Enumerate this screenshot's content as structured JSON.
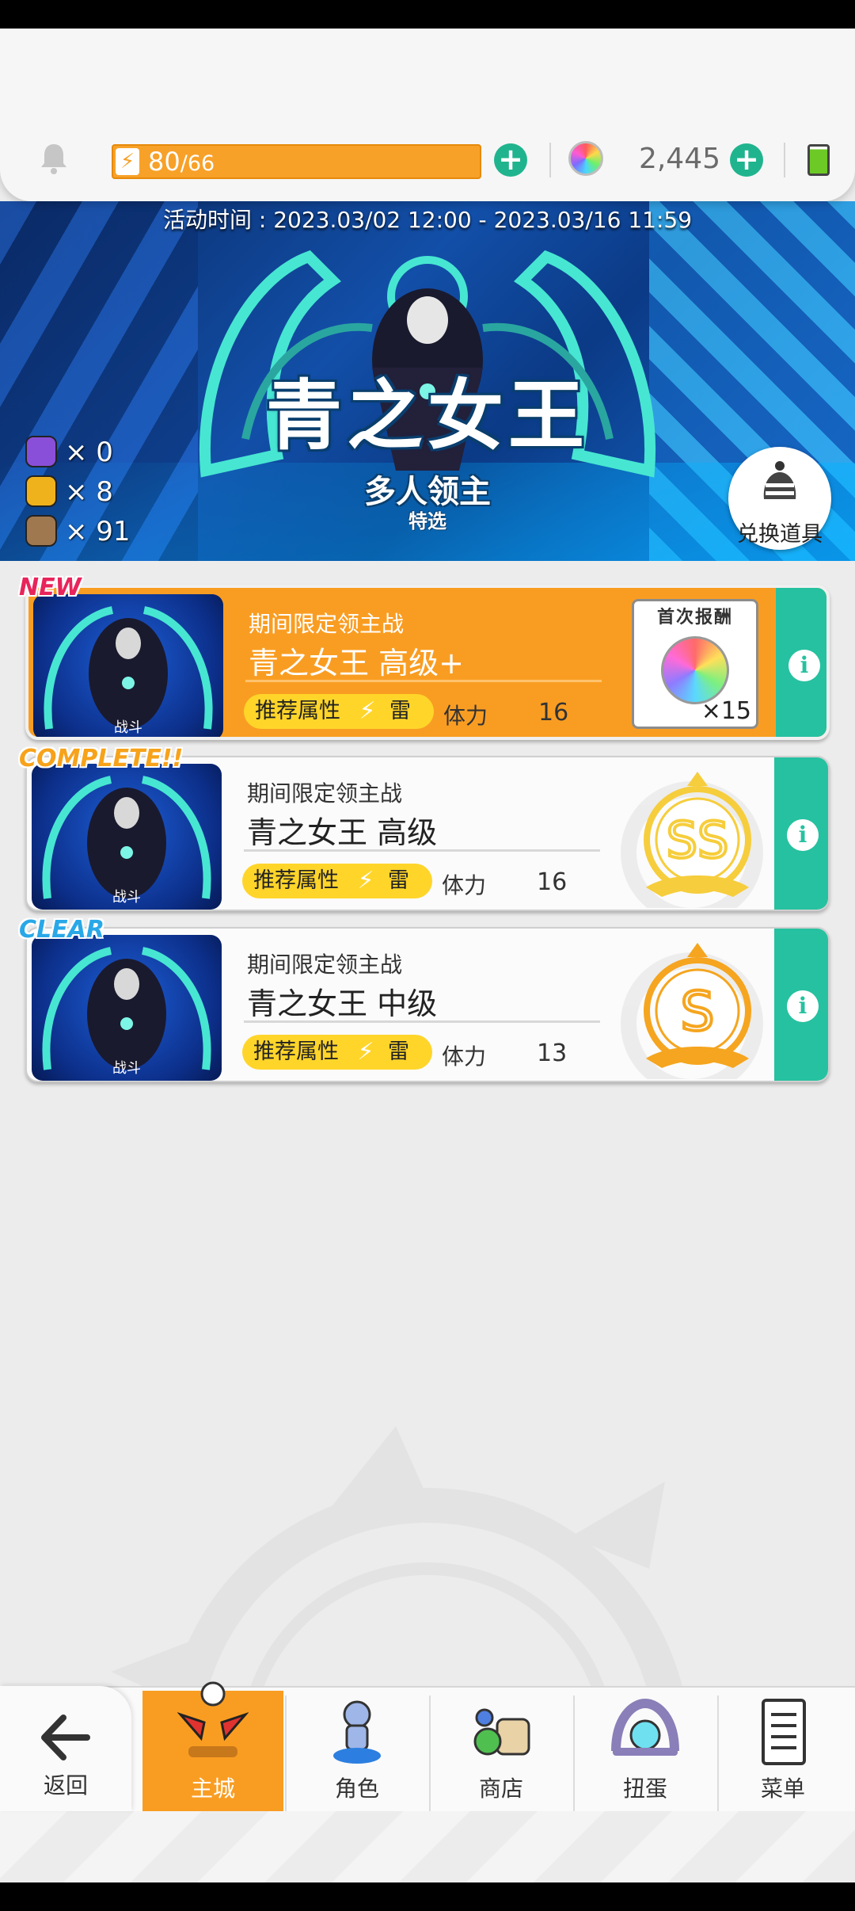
{
  "hud": {
    "stamina_current": "80",
    "stamina_max": "/66",
    "gems": "2,445"
  },
  "banner": {
    "event_time": "活动时间 : 2023.03/02 12:00 - 2023.03/16 11:59",
    "title": "青之女王",
    "subtitle": "多人领主",
    "tag": "特选",
    "tokens": [
      {
        "icon": "purple-token-icon",
        "count": "× 0",
        "color": "#8a4fd8"
      },
      {
        "icon": "gold-token-icon",
        "count": "× 8",
        "color": "#f0b21c"
      },
      {
        "icon": "bronze-token-icon",
        "count": "× 91",
        "color": "#a07850"
      }
    ],
    "exchange_label": "兑换道具"
  },
  "stages": [
    {
      "badge": "NEW",
      "fight_label": "战斗",
      "subtitle": "期间限定领主战",
      "name": "青之女王 高级+",
      "attr_label": "推荐属性",
      "element": "雷",
      "stamina_label": "体力",
      "stamina_cost": "16",
      "reward_header": "首次报酬",
      "reward_count": "×15"
    },
    {
      "badge": "COMPLETE!!",
      "fight_label": "战斗",
      "subtitle": "期间限定领主战",
      "name": "青之女王 高级",
      "attr_label": "推荐属性",
      "element": "雷",
      "stamina_label": "体力",
      "stamina_cost": "16",
      "rank": "SS"
    },
    {
      "badge": "CLEAR",
      "fight_label": "战斗",
      "subtitle": "期间限定领主战",
      "name": "青之女王 中级",
      "attr_label": "推荐属性",
      "element": "雷",
      "stamina_label": "体力",
      "stamina_cost": "13",
      "rank": "S"
    }
  ],
  "nav": {
    "back": "返回",
    "items": [
      {
        "label": "主城",
        "icon": "castle-icon",
        "active": true
      },
      {
        "label": "角色",
        "icon": "character-icon"
      },
      {
        "label": "商店",
        "icon": "shop-icon"
      },
      {
        "label": "扭蛋",
        "icon": "gacha-icon"
      },
      {
        "label": "菜单",
        "icon": "menu-icon"
      }
    ]
  },
  "colors": {
    "accent_orange": "#f99d22",
    "teal": "#26c1a0",
    "attr_yellow": "#ffd52a",
    "banner_blue": "#124fa8"
  }
}
